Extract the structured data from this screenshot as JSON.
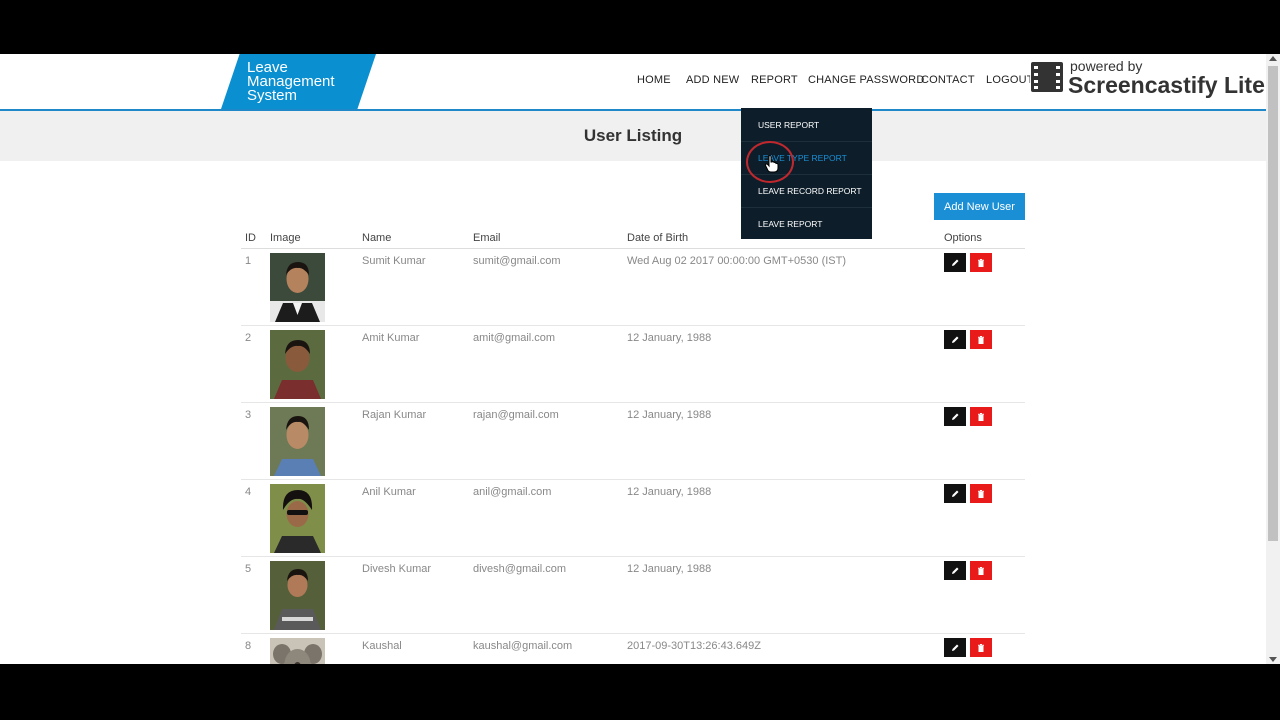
{
  "app": {
    "logo_text": [
      "Leave",
      "Management",
      "System"
    ]
  },
  "nav": {
    "items": [
      "HOME",
      "ADD NEW",
      "REPORT",
      "CHANGE PASSWORD",
      "CONTACT",
      "LOGOUT"
    ]
  },
  "report_menu": {
    "items": [
      "USER REPORT",
      "LEAVE TYPE REPORT",
      "LEAVE RECORD REPORT",
      "LEAVE REPORT"
    ],
    "active_item": "LEAVE TYPE REPORT"
  },
  "overlay": {
    "powered_by": "powered by",
    "name": "Screencastify Lite"
  },
  "page": {
    "title": "User Listing",
    "add_button": "Add New User"
  },
  "table": {
    "headers": [
      "ID",
      "Image",
      "Name",
      "Email",
      "Date of Birth",
      "Options"
    ],
    "rows": [
      {
        "id": "1",
        "name": "Sumit Kumar",
        "email": "sumit@gmail.com",
        "dob": "Wed Aug 02 2017 00:00:00 GMT+0530 (IST)"
      },
      {
        "id": "2",
        "name": "Amit Kumar",
        "email": "amit@gmail.com",
        "dob": "12 January, 1988"
      },
      {
        "id": "3",
        "name": "Rajan Kumar",
        "email": "rajan@gmail.com",
        "dob": "12 January, 1988"
      },
      {
        "id": "4",
        "name": "Anil Kumar",
        "email": "anil@gmail.com",
        "dob": "12 January, 1988"
      },
      {
        "id": "5",
        "name": "Divesh Kumar",
        "email": "divesh@gmail.com",
        "dob": "12 January, 1988"
      },
      {
        "id": "8",
        "name": "Kaushal",
        "email": "kaushal@gmail.com",
        "dob": "2017-09-30T13:26:43.649Z"
      }
    ]
  },
  "colors": {
    "brand": "#0a8fd0",
    "edit": "#111111",
    "delete": "#e81a1a",
    "menu_bg": "#0d1e2a"
  }
}
